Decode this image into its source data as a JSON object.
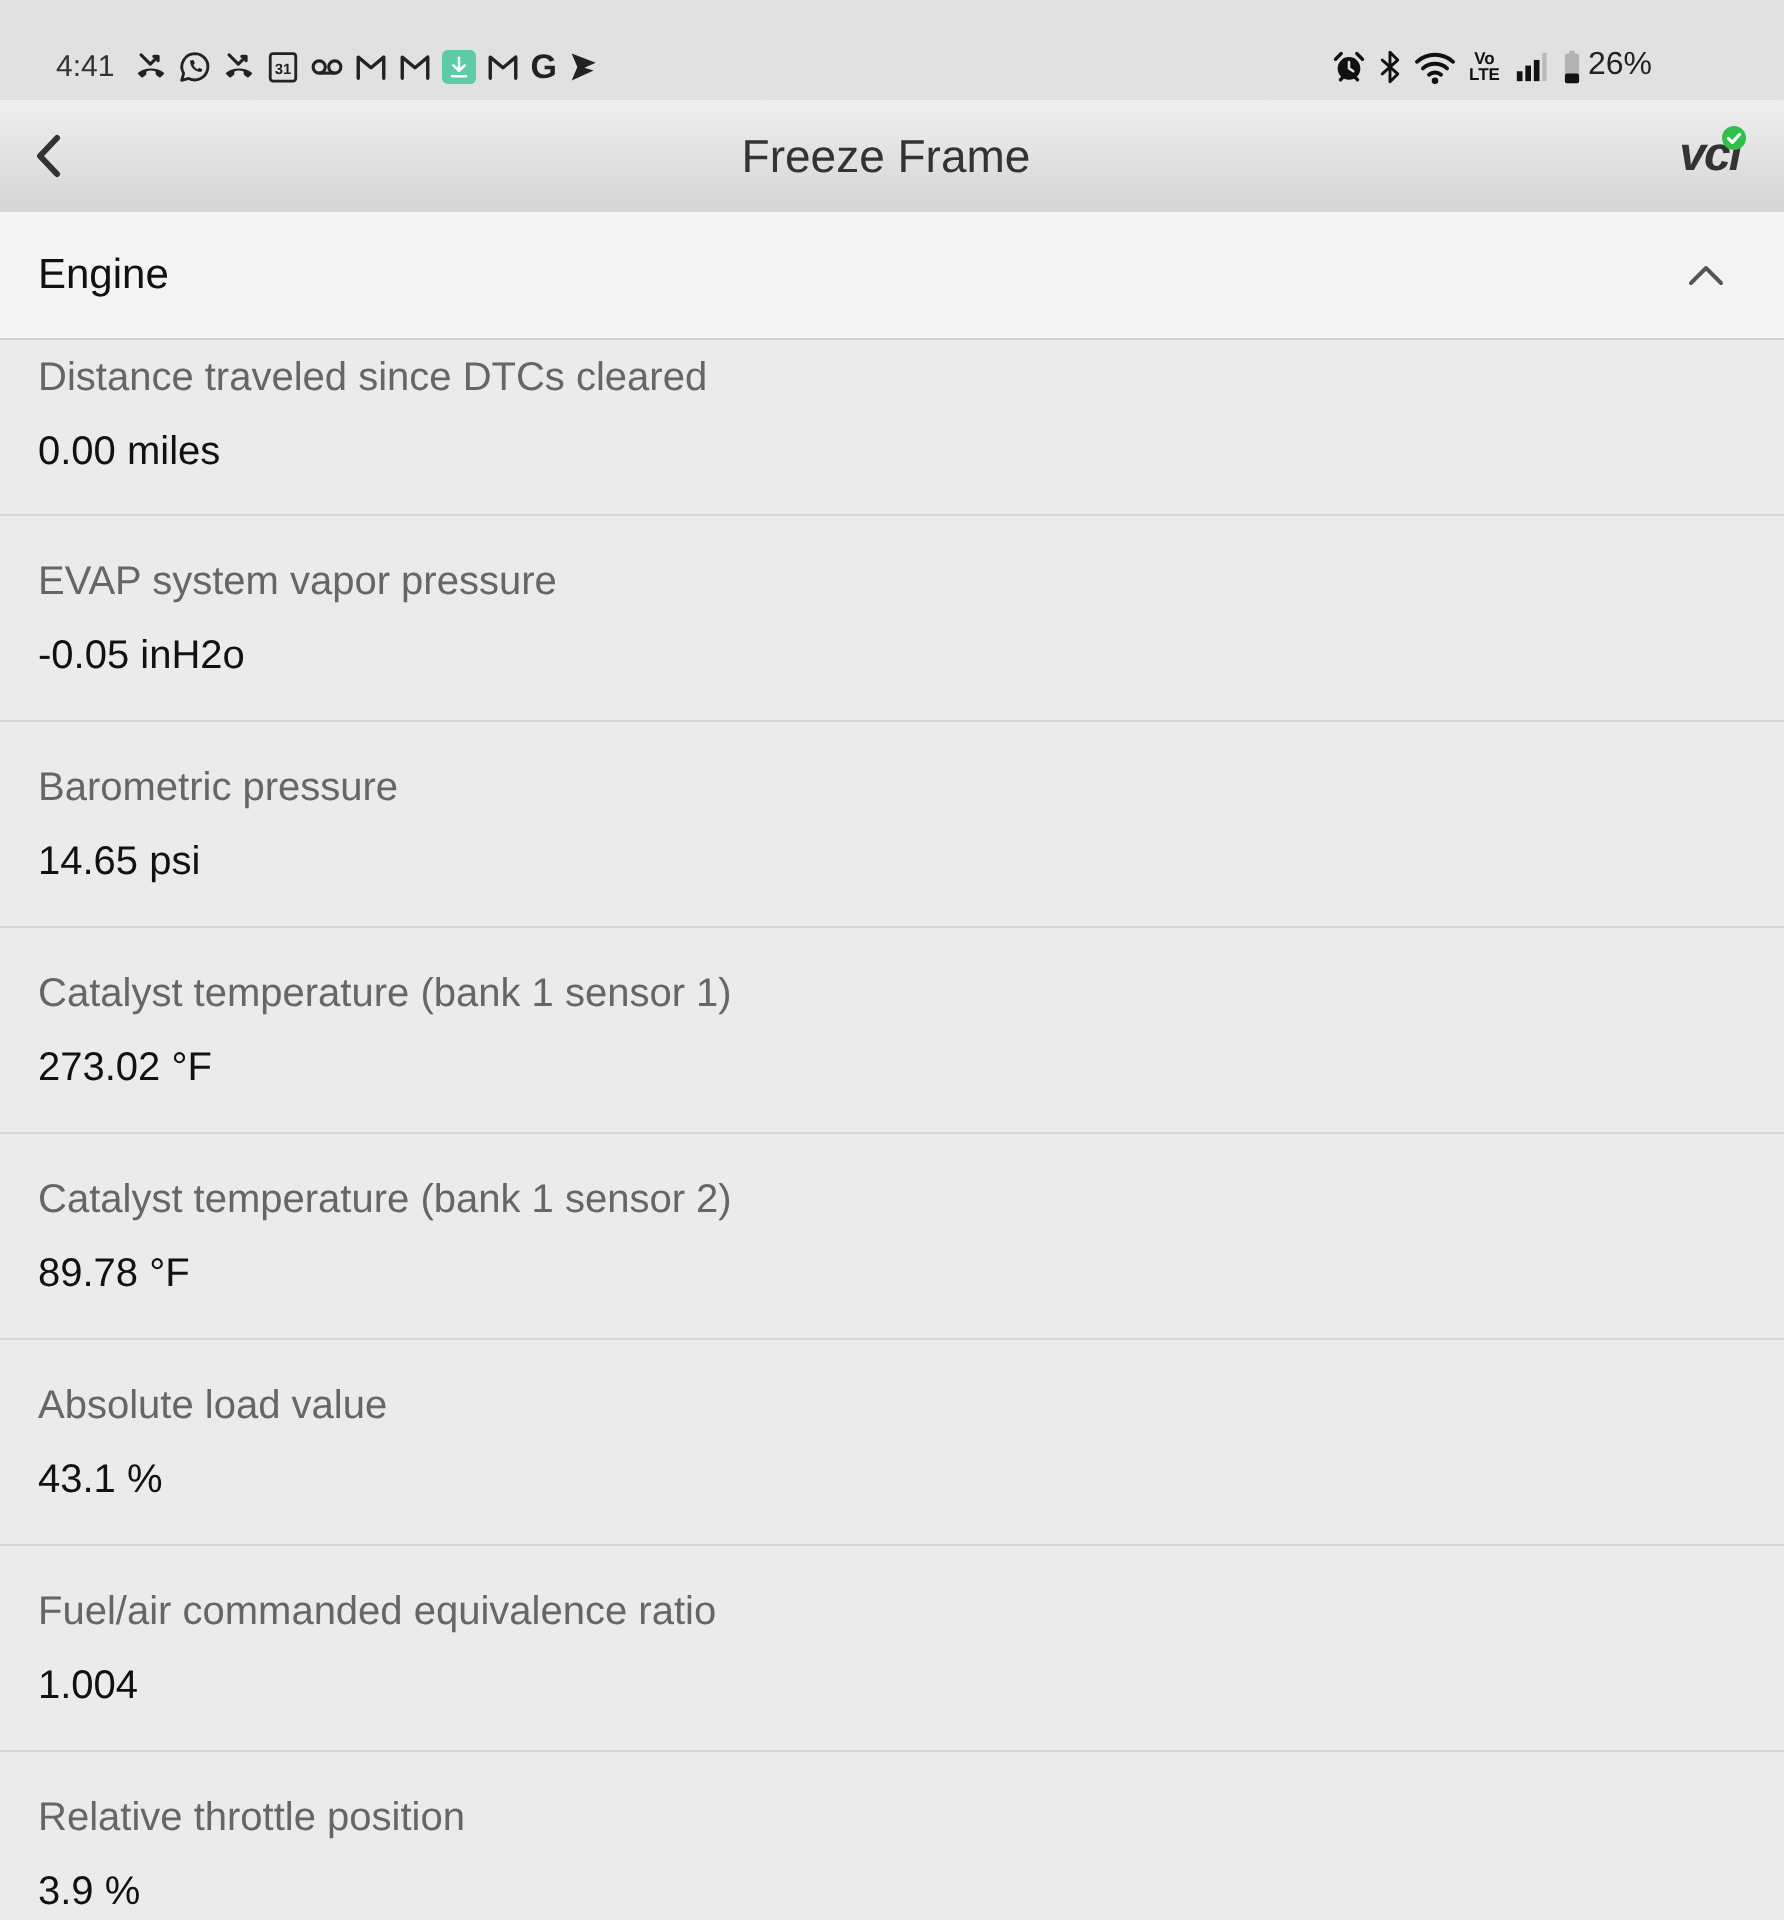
{
  "status_bar": {
    "time": "4:41",
    "notifications": [
      {
        "kind": "missed-call"
      },
      {
        "kind": "chat"
      },
      {
        "kind": "missed-call"
      },
      {
        "kind": "calendar",
        "text": "31"
      },
      {
        "kind": "voicemail"
      },
      {
        "kind": "mail"
      },
      {
        "kind": "mail"
      },
      {
        "kind": "download"
      },
      {
        "kind": "mail"
      },
      {
        "kind": "letter",
        "text": "G"
      },
      {
        "kind": "pennant"
      }
    ],
    "system_icons": [
      {
        "kind": "alarm"
      },
      {
        "kind": "bluetooth"
      },
      {
        "kind": "wifi"
      },
      {
        "kind": "network-label",
        "lines": [
          "Vo",
          "LTE"
        ]
      },
      {
        "kind": "signal"
      },
      {
        "kind": "battery"
      }
    ],
    "battery_percent": "26%"
  },
  "header": {
    "title": "Freeze Frame",
    "logo": "vci",
    "connected": true
  },
  "section": {
    "title": "Engine",
    "expanded": true,
    "rows": [
      {
        "label": "Distance traveled since DTCs cleared",
        "value": "0.00 miles"
      },
      {
        "label": "EVAP system vapor pressure",
        "value": "-0.05 inH2o"
      },
      {
        "label": "Barometric pressure",
        "value": "14.65 psi"
      },
      {
        "label": "Catalyst temperature (bank 1 sensor 1)",
        "value": "273.02 °F"
      },
      {
        "label": "Catalyst temperature (bank 1 sensor 2)",
        "value": "89.78 °F"
      },
      {
        "label": "Absolute load value",
        "value": "43.1 %"
      },
      {
        "label": "Fuel/air commanded equivalence ratio",
        "value": "1.004"
      },
      {
        "label": "Relative throttle position",
        "value": "3.9 %"
      }
    ]
  }
}
